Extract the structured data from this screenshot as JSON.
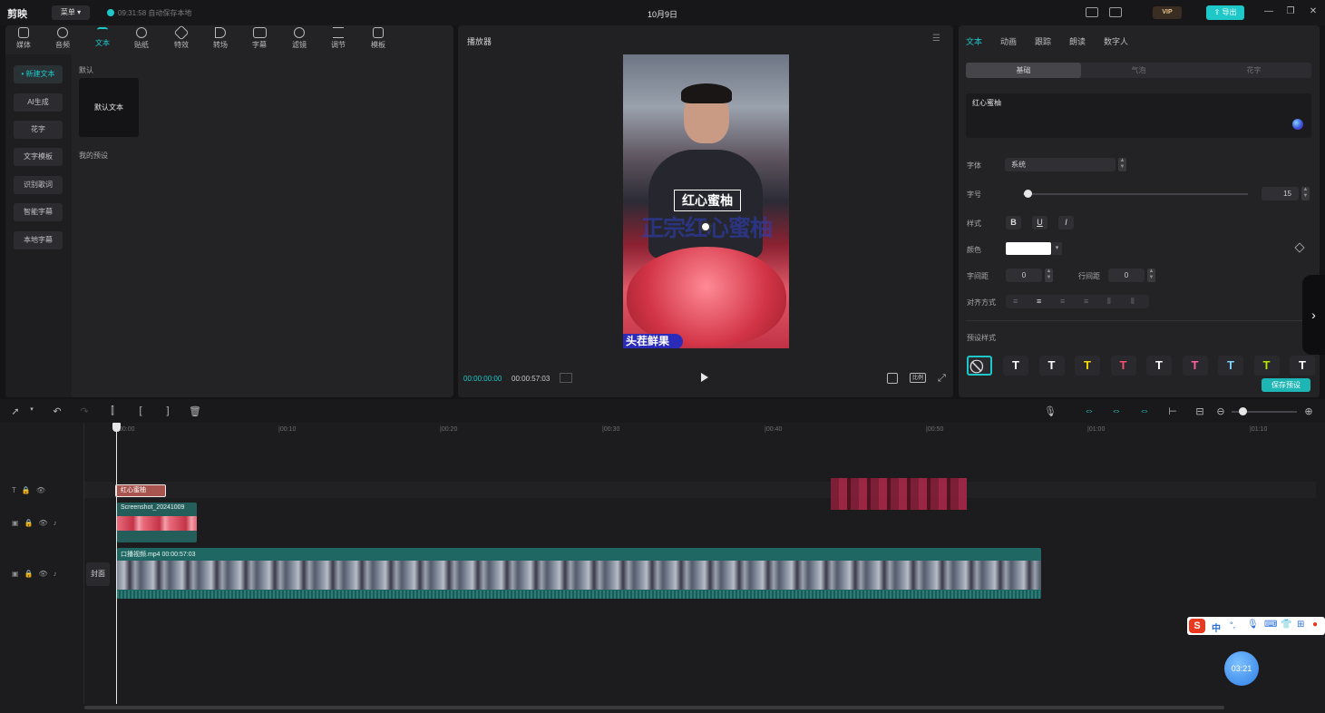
{
  "app": {
    "name": "剪映",
    "menu_label": "菜单",
    "autosave": "09:31:58 自动保存本地",
    "doc_title": "10月9日",
    "vip_label": "VIP",
    "export_label": "导出"
  },
  "toolbar": {
    "tools": [
      {
        "label": "媒体",
        "icon": "media-icon"
      },
      {
        "label": "音频",
        "icon": "audio-icon"
      },
      {
        "label": "文本",
        "icon": "text-icon"
      },
      {
        "label": "贴纸",
        "icon": "sticker-icon"
      },
      {
        "label": "特效",
        "icon": "effects-icon"
      },
      {
        "label": "转场",
        "icon": "transition-icon"
      },
      {
        "label": "字幕",
        "icon": "caption-icon"
      },
      {
        "label": "滤镜",
        "icon": "filter-icon"
      },
      {
        "label": "调节",
        "icon": "adjust-icon"
      },
      {
        "label": "模板",
        "icon": "template-icon"
      }
    ],
    "active_index": 2
  },
  "text_sidebar": {
    "items": [
      "• 新建文本",
      "AI生成",
      "花字",
      "文字模板",
      "识别歌词",
      "智能字幕",
      "本地字幕"
    ],
    "default_header": "默认",
    "default_card": "默认文本",
    "my_presets": "我的预设"
  },
  "player": {
    "title": "播放器",
    "caption_overlay": "红心蜜柚",
    "big_overlay": "正宗红心蜜柚",
    "bottom_overlay": "头茬鲜果",
    "time_current": "00:00:00:00",
    "time_total": "00:00:57:03",
    "ratio_label": "比例"
  },
  "inspector": {
    "tabs": [
      "文本",
      "动画",
      "跟踪",
      "朗读",
      "数字人"
    ],
    "subtabs": [
      "基础",
      "气泡",
      "花字"
    ],
    "text_value": "红心蜜柚",
    "font_label": "字体",
    "font_value": "系统",
    "size_label": "字号",
    "size_value": "15",
    "size_level": 0.02,
    "style_label": "样式",
    "style_buttons": [
      "B",
      "U",
      "I"
    ],
    "color_label": "颜色",
    "text_color": "#ffffff",
    "char_spacing_label": "字间距",
    "char_spacing_value": "0",
    "line_spacing_label": "行间距",
    "line_spacing_value": "0",
    "align_label": "对齐方式",
    "preset_style_label": "预设样式",
    "preset_colors": [
      "#ffffff",
      "#ffffff",
      "#f5d900",
      "#ff4d6d",
      "#ffffff",
      "#ff5fa2",
      "#7fd3ff",
      "#b8e600",
      "#ffffff"
    ],
    "save_preset": "保存预设"
  },
  "timeline": {
    "ruler": [
      "00:00",
      "|00:10",
      "|00:20",
      "|00:30",
      "|00:40",
      "|00:50",
      "|01:00",
      "|01:10"
    ],
    "text_clip": "红心蜜柚",
    "screenshot_clip": "Screenshot_20241009",
    "main_clip": "口播视频.mp4  00:00:57:03",
    "cover_label": "封面"
  },
  "overlay": {
    "timer": "03:21",
    "ime_label": "中"
  },
  "colors": {
    "accent": "#1ec8c8",
    "bg": "#141416"
  }
}
